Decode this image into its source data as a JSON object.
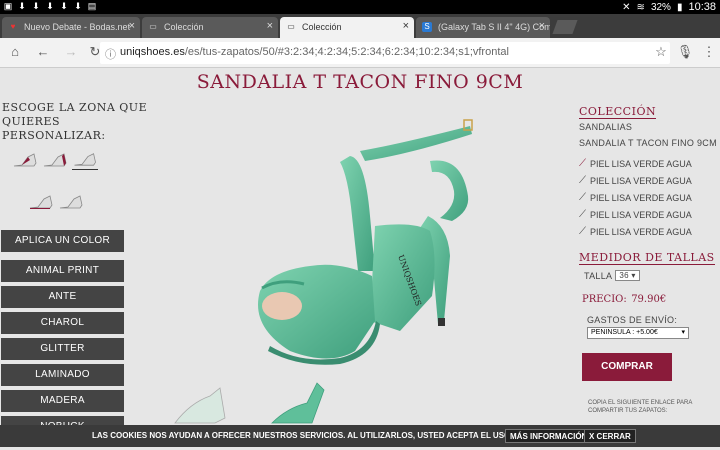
{
  "status": {
    "battery": "32%",
    "time": "10:38"
  },
  "tabs": [
    {
      "label": "Nuevo Debate - Bodas.net",
      "favicon": "heart-icon"
    },
    {
      "label": "Colección",
      "favicon": "page-icon"
    },
    {
      "label": "Colección",
      "favicon": "page-icon"
    },
    {
      "label": "(Galaxy Tab S II 4\" 4G) Com",
      "favicon": "s-icon"
    }
  ],
  "address": {
    "host": "uniqshoes.es",
    "path": "/es/tus-zapatos/50/#3:2:34;4:2:34;5:2:34;6:2:34;10:2:34;s1;vfrontal"
  },
  "page": {
    "title": "SANDALIA T TACON FINO 9CM",
    "zone_label": "ESCOGE LA ZONA QUE QUIERES PERSONALIZAR:",
    "side_buttons": [
      "APLICA UN COLOR",
      "ANIMAL PRINT",
      "ANTE",
      "CHAROL",
      "GLITTER",
      "LAMINADO",
      "MADERA",
      "NOBUCK"
    ]
  },
  "collection": {
    "head": "COLECCIÓN",
    "category": "SANDALIAS",
    "model": "SANDALIA T TACON FINO 9CM",
    "parts": [
      "PIEL LISA VERDE AGUA",
      "PIEL LISA VERDE AGUA",
      "PIEL LISA VERDE AGUA",
      "PIEL LISA VERDE AGUA",
      "PIEL LISA VERDE AGUA"
    ]
  },
  "sizes": {
    "head": "MEDIDOR DE TALLAS",
    "talla_label": "TALLA",
    "talla_value": "36"
  },
  "purchase": {
    "price_label": "PRECIO:",
    "price": "79.90€",
    "shipping_label": "GASTOS DE ENVÍO:",
    "shipping_value": "PENINSULA : +5.00€",
    "buy": "COMPRAR",
    "share_text": "COPIA EL SIGUIENTE ENLACE PARA COMPARTIR TUS ZAPATOS:"
  },
  "cookie": {
    "text": "LAS COOKIES NOS AYUDAN A OFRECER NUESTROS SERVICIOS. AL UTILIZARLOS, USTED ACEPTA EL USO DE COOKIES.",
    "more": "MÁS INFORMACIÓN",
    "close": "X CERRAR"
  },
  "colors": {
    "brand": "#8a1b3a",
    "shoe": "#5fbf9a"
  }
}
